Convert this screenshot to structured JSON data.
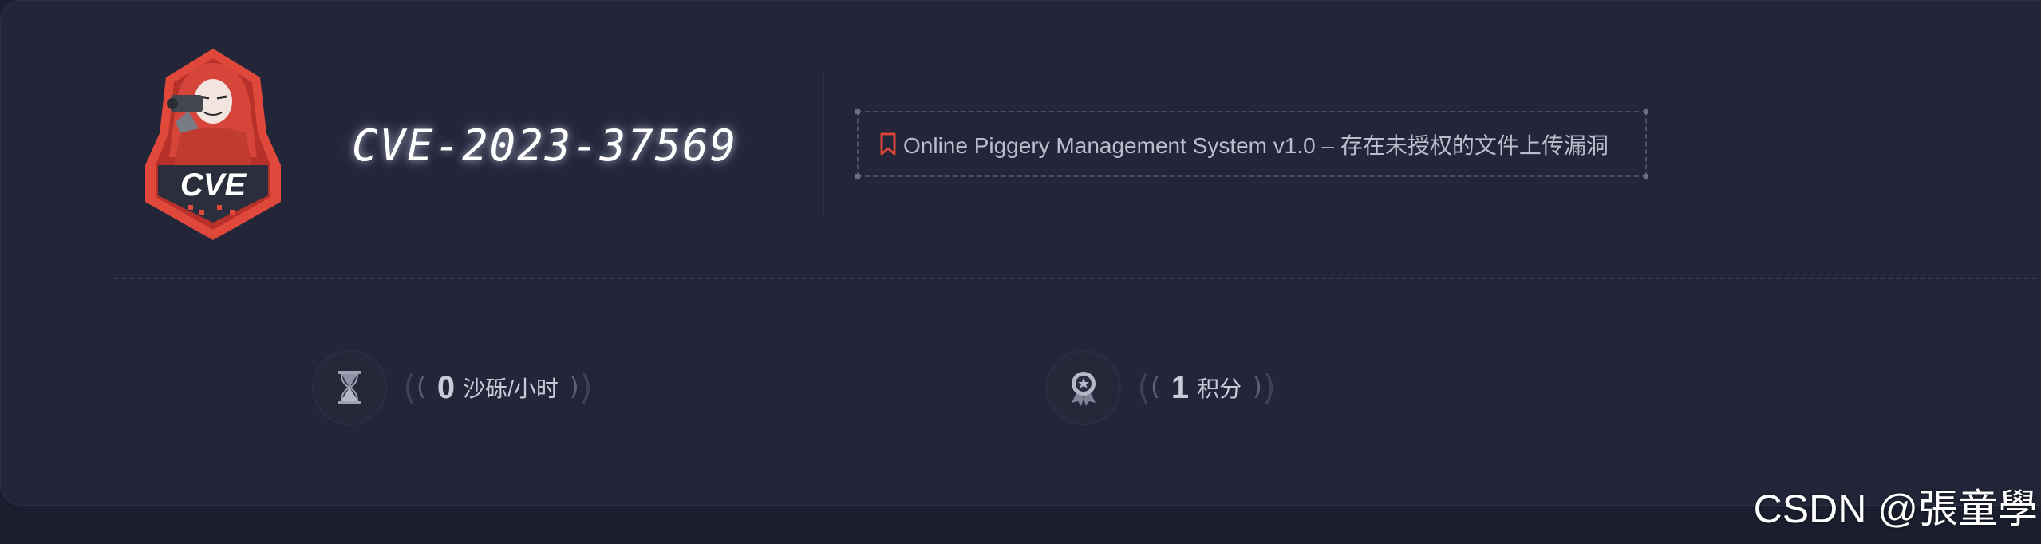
{
  "header": {
    "logo_text": "CVE",
    "cve_id": "CVE-2023-37569",
    "vulnerability_title": "Online Piggery Management System v1.0 – 存在未授权的文件上传漏洞"
  },
  "stats": {
    "sand": {
      "open_paren": "(",
      "value": "0",
      "unit": "沙砾/小时",
      "close_paren": ")",
      "icon": "hourglass-icon"
    },
    "points": {
      "open_paren": "(",
      "value": "1",
      "unit": "积分",
      "close_paren": ")",
      "icon": "medal-icon"
    }
  },
  "watermark": "CSDN @張童學",
  "colors": {
    "background": "#1b1e2e",
    "card": "#232639",
    "logo_red": "#e0483b",
    "bookmark_red": "#d9443b",
    "text_muted": "#b9bdcc"
  }
}
